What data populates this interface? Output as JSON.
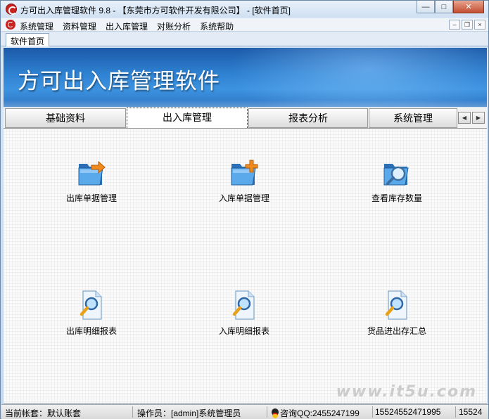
{
  "window": {
    "title": "方可出入库管理软件 9.8 - 【东莞市方可软件开发有限公司】 - [软件首页]",
    "controls": {
      "minimize": "—",
      "maximize": "□",
      "close": "✕"
    }
  },
  "menubar": {
    "items": [
      "系统管理",
      "资料管理",
      "出入库管理",
      "对账分析",
      "系统帮助"
    ],
    "mdi_controls": {
      "minimize": "–",
      "restore": "❐",
      "close": "×"
    }
  },
  "doc_tab": {
    "label": "软件首页"
  },
  "banner": {
    "title": "方可出入库管理软件"
  },
  "module_tabs": {
    "items": [
      "基础资料",
      "出入库管理",
      "报表分析",
      "系统管理"
    ],
    "active_index": 1,
    "scroll_left": "◀",
    "scroll_right": "▶"
  },
  "functions": [
    {
      "label": "出库单据管理",
      "icon": "folder-export-icon"
    },
    {
      "label": "入库单据管理",
      "icon": "folder-add-icon"
    },
    {
      "label": "查看库存数量",
      "icon": "folder-search-icon"
    },
    {
      "label": "出库明细报表",
      "icon": "document-search-icon"
    },
    {
      "label": "入库明细报表",
      "icon": "document-search-icon"
    },
    {
      "label": "货品进出存汇总",
      "icon": "document-search-icon"
    }
  ],
  "watermark": "www.it5u.com",
  "statusbar": {
    "account": "当前帐套：默认账套",
    "operator": "操作员：[admin]系统管理员",
    "qq": "咨询QQ:2455247199",
    "phone": "15524552471995",
    "extra": "15524"
  },
  "colors": {
    "banner_blue": "#2f82d2",
    "brand_red": "#c8221f",
    "folder_blue": "#3d8fd8",
    "arrow_orange": "#f08a1c"
  }
}
